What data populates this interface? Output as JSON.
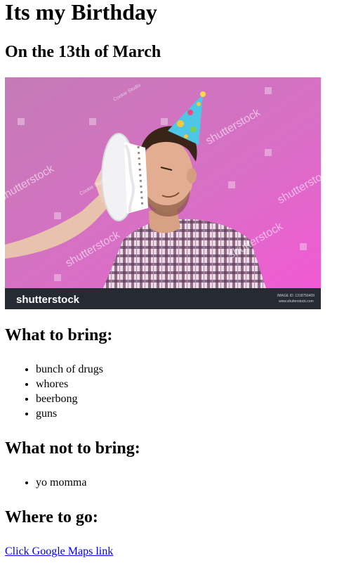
{
  "page": {
    "title": "Its my Birthday",
    "subtitle": "On the 13th of March"
  },
  "photo": {
    "description_icon": "birthday-cake-photo",
    "watermark": "shutterstock",
    "studio_watermark": "Cookie Studio",
    "footer_logo": "shutterstock",
    "image_id": "IMAGE ID: 1318756409",
    "site": "www.shutterstock.com",
    "colors": {
      "background_top": "#c77ab8",
      "background_bottom": "#f05ad0",
      "footer": "#262a33"
    }
  },
  "bring": {
    "heading": "What to bring:",
    "items": [
      "bunch of drugs",
      "whores",
      "beerbong",
      "guns"
    ]
  },
  "not_bring": {
    "heading": "What not to bring:",
    "items": [
      "yo momma"
    ]
  },
  "where": {
    "heading": "Where to go:",
    "link_text": "Click Google Maps link"
  },
  "colors": {
    "link": "#0000ee",
    "text": "#000000"
  }
}
